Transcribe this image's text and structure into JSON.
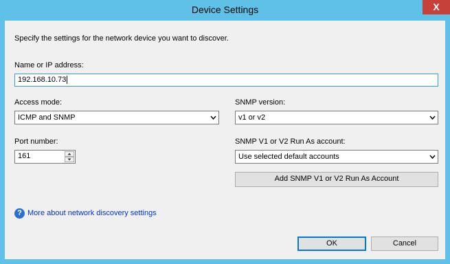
{
  "window": {
    "title": "Device Settings",
    "close_glyph": "X"
  },
  "intro": "Specify the settings for the network device you want to discover.",
  "name": {
    "label": "Name or IP address:",
    "value": "192.168.10.73"
  },
  "access_mode": {
    "label": "Access mode:",
    "value": "ICMP and SNMP"
  },
  "snmp_version": {
    "label": "SNMP version:",
    "value": "v1 or v2"
  },
  "port": {
    "label": "Port number:",
    "value": "161"
  },
  "runas": {
    "label": "SNMP V1 or V2 Run As account:",
    "value": "Use selected default accounts"
  },
  "add_account_button": "Add SNMP V1 or V2 Run As Account",
  "help": {
    "icon": "?",
    "link_text": "More about network discovery settings"
  },
  "buttons": {
    "ok": "OK",
    "cancel": "Cancel"
  },
  "colors": {
    "frame": "#5fc1e8",
    "close": "#c7403a",
    "focus": "#3399ff",
    "link": "#0033cc"
  },
  "icons": [
    "close-icon",
    "chevron-down-icon",
    "spin-up-icon",
    "spin-down-icon",
    "help-icon"
  ]
}
